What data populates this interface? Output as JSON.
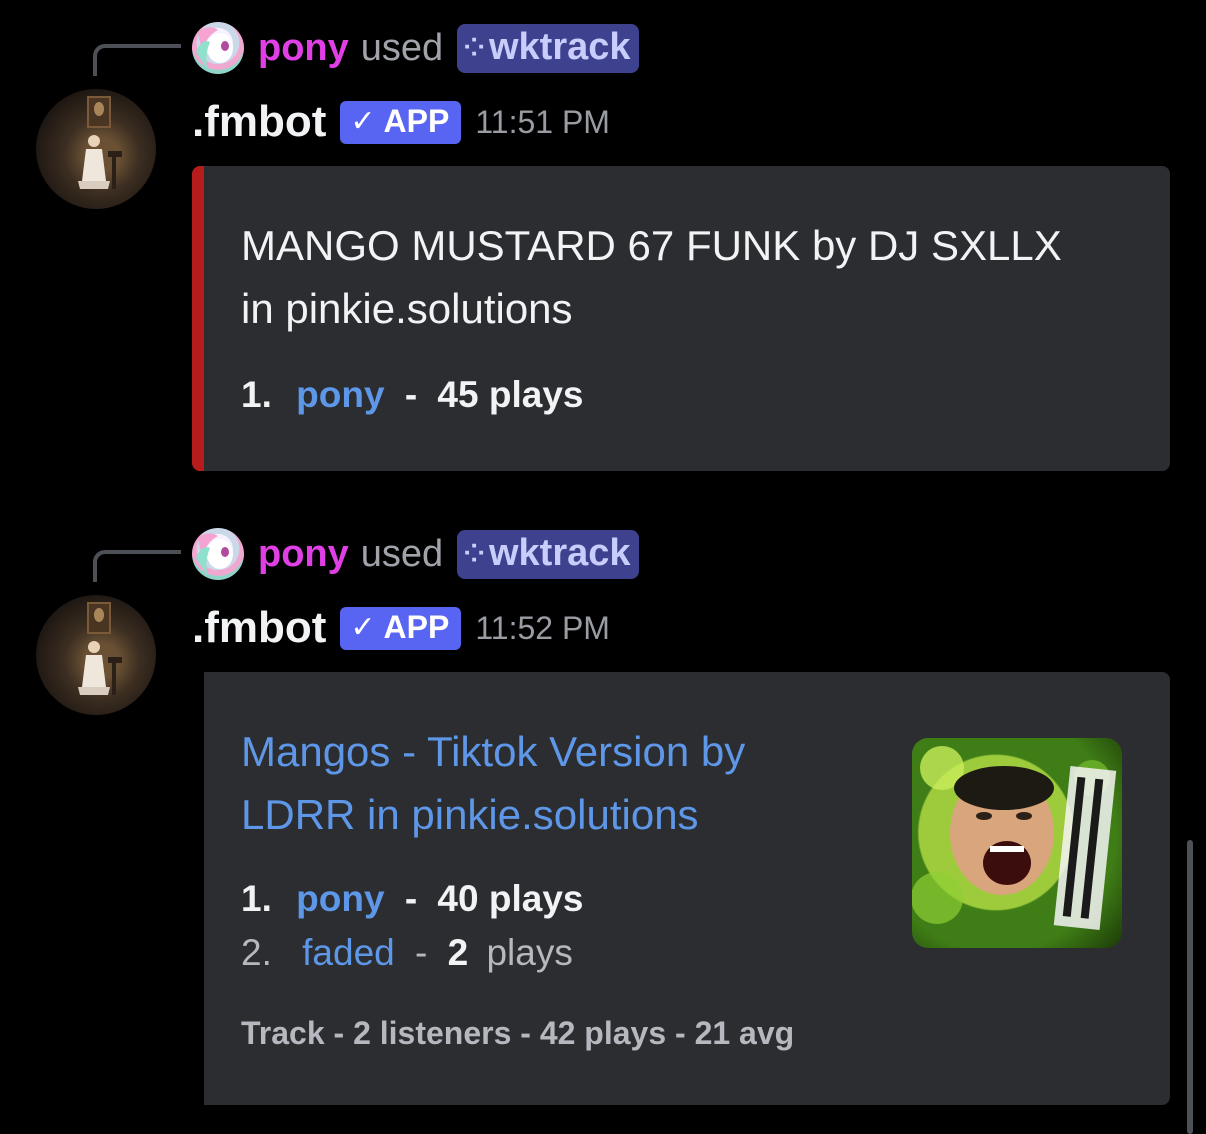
{
  "messages": [
    {
      "reply": {
        "user": "pony",
        "action": "used",
        "command": "wktrack"
      },
      "author": ".fmbot",
      "badge": "APP",
      "time": "11:51 PM",
      "embed": {
        "title_line1": "MANGO MUSTARD 67 FUNK by DJ SXLLX",
        "title_line2": "in pinkie.solutions",
        "entries": [
          {
            "rank": "1.",
            "user": "pony",
            "sep": "-",
            "plays": "45 plays"
          }
        ]
      }
    },
    {
      "reply": {
        "user": "pony",
        "action": "used",
        "command": "wktrack"
      },
      "author": ".fmbot",
      "badge": "APP",
      "time": "11:52 PM",
      "embed": {
        "title_line1": "Mangos - Tiktok Version by",
        "title_line2": "LDRR in pinkie.solutions",
        "entries": [
          {
            "rank": "1.",
            "user": "pony",
            "sep": "-",
            "plays": "40 plays"
          },
          {
            "rank": "2.",
            "user": "faded",
            "sep": "-",
            "count": "2",
            "unit": "plays"
          }
        ],
        "footer": "Track - 2 listeners - 42 plays - 21 avg"
      }
    }
  ],
  "icons": {
    "reply_avatar": "pony-avatar-icon",
    "bot_avatar": "fmbot-avatar-icon",
    "command": "slash-command-icon",
    "check": "checkmark-icon"
  },
  "colors": {
    "accent_bar": "#b71c1c",
    "link": "#5f97e8",
    "username": "#e13fe6",
    "badge": "#5865f2"
  }
}
